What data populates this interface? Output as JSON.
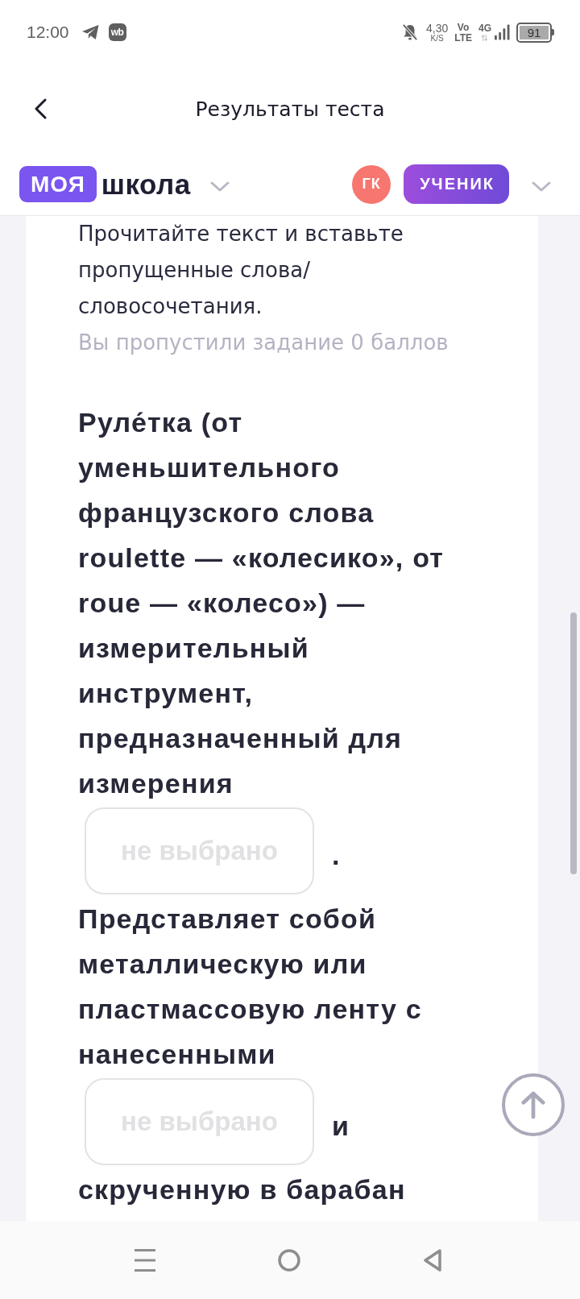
{
  "status_bar": {
    "time": "12:00",
    "app_badge": "wb",
    "net_speed": "4,30",
    "net_speed_unit": "K/S",
    "volte_top": "Vo",
    "volte_bottom": "LTE",
    "network": "4G",
    "battery": "91"
  },
  "header": {
    "title": "Результаты теста"
  },
  "brand_bar": {
    "logo_badge": "МОЯ",
    "logo_text": "школа",
    "avatar_initials": "ГК",
    "role": "УЧЕНИК"
  },
  "task": {
    "instruction": "Прочитайте текст и вставьте пропущенные слова/словосочетания.",
    "status": "Вы пропустили задание 0 баллов",
    "passage": [
      {
        "kind": "text",
        "text": "Руле́тка (от уменьшительного французского слова roulette — «колесико», от roue — «колесо») — измерительный инструмент, предназначенный для измерения"
      },
      {
        "kind": "blank",
        "placeholder": "не выбрано",
        "after": "."
      },
      {
        "kind": "text",
        "text": "Представляет собой металлическую или пластмассовую ленту с нанесенными"
      },
      {
        "kind": "blank",
        "placeholder": "не выбрано",
        "after": "и"
      },
      {
        "kind": "text",
        "text": "скрученную в барабан"
      }
    ]
  }
}
